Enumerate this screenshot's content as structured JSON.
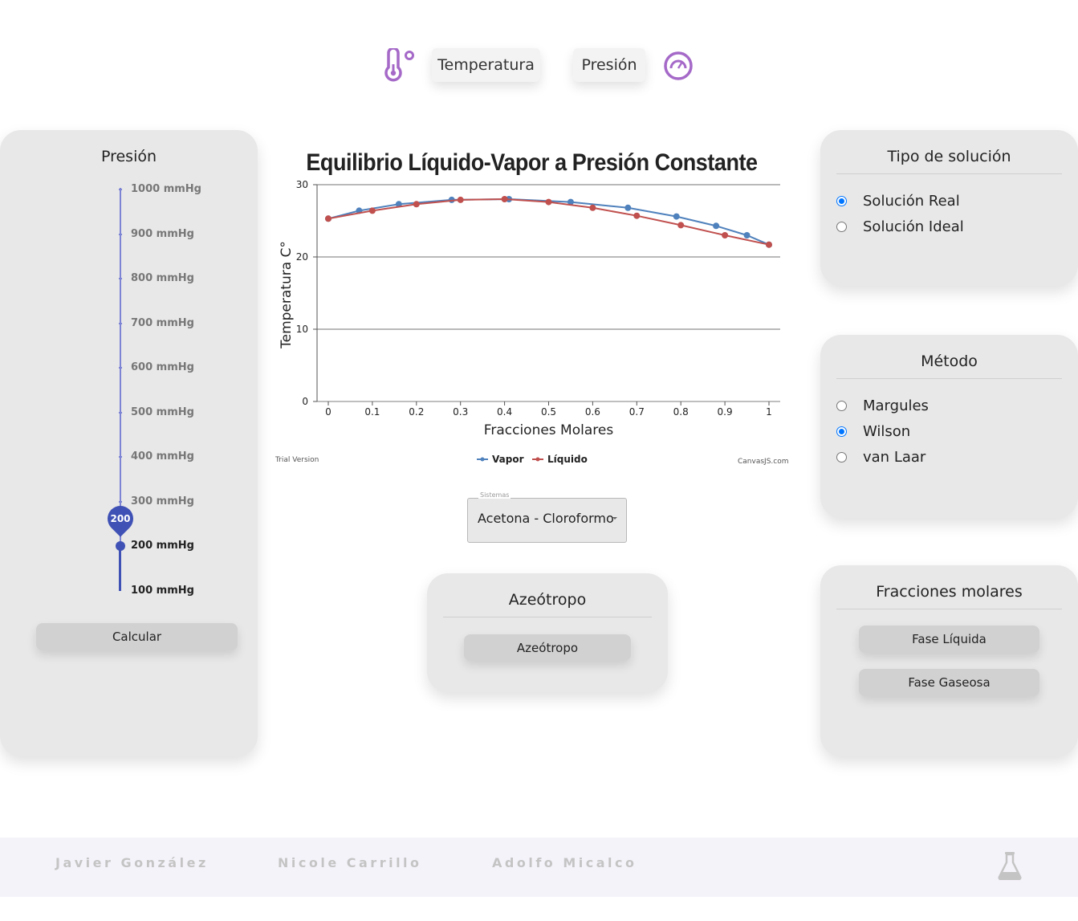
{
  "header": {
    "temperature_button": "Temperatura",
    "pressure_button": "Presión",
    "thermometer_icon": "thermometer-icon",
    "gauge_icon": "gauge-icon"
  },
  "pressure_panel": {
    "title": "Presión",
    "ticks": [
      "1000 mmHg",
      "900 mmHg",
      "800 mmHg",
      "700 mmHg",
      "600 mmHg",
      "500 mmHg",
      "400 mmHg",
      "300 mmHg",
      "200 mmHg",
      "100 mmHg"
    ],
    "slider_value": "200",
    "calculate_button": "Calcular"
  },
  "chart_data": {
    "type": "line",
    "title": "Equilibrio Líquido-Vapor a Presión Constante",
    "xlabel": "Fracciones Molares",
    "ylabel": "Temperatura C°",
    "xlim": [
      0,
      1
    ],
    "ylim": [
      0,
      30
    ],
    "x_ticks": [
      "0",
      "0.1",
      "0.2",
      "0.3",
      "0.4",
      "0.5",
      "0.6",
      "0.7",
      "0.8",
      "0.9",
      "1"
    ],
    "y_ticks": [
      "0",
      "10",
      "20",
      "30"
    ],
    "grid": "horizontal",
    "legend_position": "bottom",
    "series": [
      {
        "name": "Vapor",
        "color": "#4f81bc",
        "points": [
          [
            0,
            25.3
          ],
          [
            0.07,
            26.4
          ],
          [
            0.16,
            27.3
          ],
          [
            0.28,
            27.9
          ],
          [
            0.41,
            28.0
          ],
          [
            0.55,
            27.6
          ],
          [
            0.68,
            26.8
          ],
          [
            0.79,
            25.6
          ],
          [
            0.88,
            24.3
          ],
          [
            0.95,
            23.0
          ],
          [
            1,
            21.7
          ]
        ]
      },
      {
        "name": "Líquido",
        "color": "#c0504e",
        "points": [
          [
            0,
            25.3
          ],
          [
            0.1,
            26.4
          ],
          [
            0.2,
            27.3
          ],
          [
            0.3,
            27.9
          ],
          [
            0.4,
            28.0
          ],
          [
            0.5,
            27.6
          ],
          [
            0.6,
            26.8
          ],
          [
            0.7,
            25.7
          ],
          [
            0.8,
            24.4
          ],
          [
            0.9,
            23.0
          ],
          [
            1,
            21.7
          ]
        ]
      }
    ],
    "watermark_left": "Trial Version",
    "watermark_right": "CanvasJS.com"
  },
  "system_select": {
    "legend": "Sistemas",
    "value": "Acetona - Cloroformo"
  },
  "azeotrope_panel": {
    "title": "Azeótropo",
    "button": "Azeótropo"
  },
  "solution_panel": {
    "title": "Tipo de solución",
    "options": [
      {
        "label": "Solución Real",
        "checked": true
      },
      {
        "label": "Solución Ideal",
        "checked": false
      }
    ]
  },
  "method_panel": {
    "title": "Método",
    "options": [
      {
        "label": "Margules",
        "checked": false
      },
      {
        "label": "Wilson",
        "checked": true
      },
      {
        "label": "van Laar",
        "checked": false
      }
    ]
  },
  "fractions_panel": {
    "title": "Fracciones molares",
    "liquid_button": "Fase Líquida",
    "gas_button": "Fase Gaseosa"
  },
  "footer": {
    "authors": [
      "Javier González",
      "Nicole Carrillo",
      "Adolfo Micalco"
    ],
    "logo_icon": "flask-icon"
  }
}
